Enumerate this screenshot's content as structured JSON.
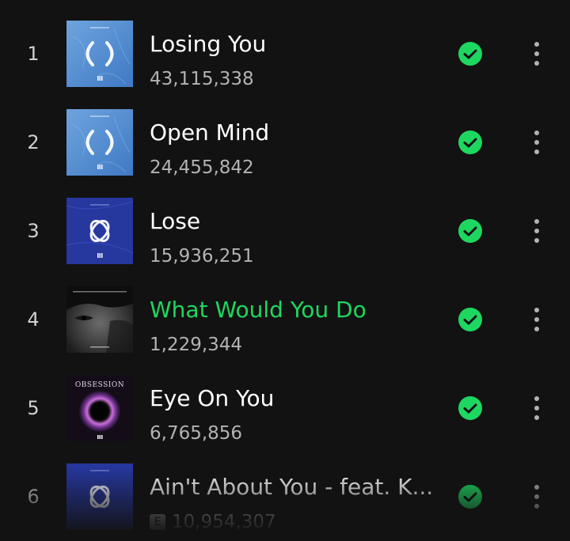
{
  "accent_color": "#1ed760",
  "tracks": [
    {
      "rank": "1",
      "title": "Losing You",
      "plays": "43,115,338",
      "explicit": false,
      "playing": false,
      "downloaded": true,
      "cover": "parentheses-blue"
    },
    {
      "rank": "2",
      "title": "Open Mind",
      "plays": "24,455,842",
      "explicit": false,
      "playing": false,
      "downloaded": true,
      "cover": "parentheses-blue"
    },
    {
      "rank": "3",
      "title": "Lose",
      "plays": "15,936,251",
      "explicit": false,
      "playing": false,
      "downloaded": true,
      "cover": "infinity-navy"
    },
    {
      "rank": "4",
      "title": "What Would You Do",
      "plays": "1,229,344",
      "explicit": false,
      "playing": true,
      "downloaded": true,
      "cover": "portrait-dark"
    },
    {
      "rank": "5",
      "title": "Eye On You",
      "plays": "6,765,856",
      "explicit": false,
      "playing": false,
      "downloaded": true,
      "cover": "obsession-ring",
      "cover_text": "OBSESSION"
    },
    {
      "rank": "6",
      "title": "Ain't About You - feat. K...",
      "plays": "10,954,307",
      "explicit": true,
      "explicit_label": "E",
      "playing": false,
      "downloaded": true,
      "cover": "infinity-navy"
    }
  ]
}
